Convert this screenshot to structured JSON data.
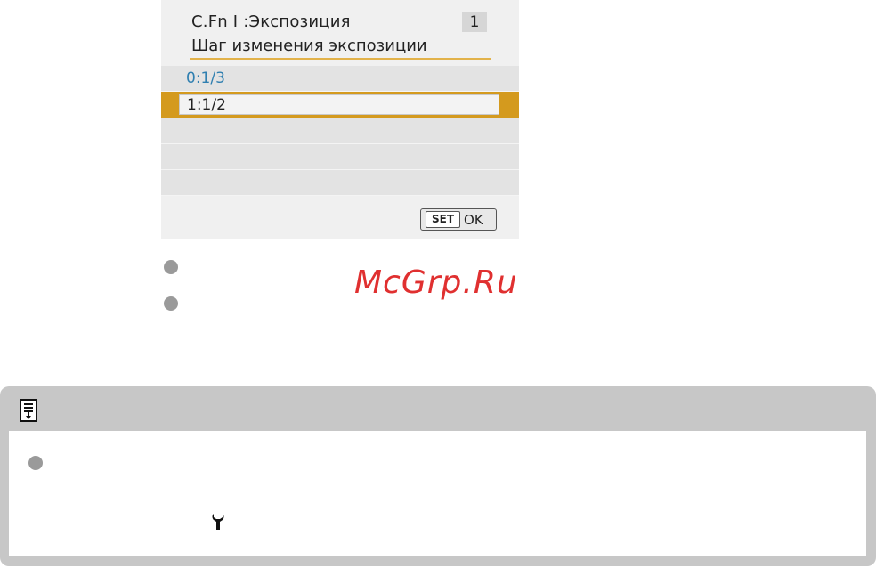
{
  "camera_screen": {
    "title": "C.Fn I :Экспозиция",
    "page_number": "1",
    "subtitle": "Шаг изменения экспозиции",
    "options": [
      "0:1/3",
      "1:1/2"
    ],
    "selected_index": 1,
    "set_label": "SET",
    "ok_label": "OK",
    "colors": {
      "highlight": "#d49a1e",
      "option_text": "#2f7fb0",
      "underline": "#e2b24a"
    }
  },
  "watermark": "McGrp.Ru",
  "note": {
    "header_icon": "memo-icon",
    "inline_icon": "wrench-icon"
  }
}
